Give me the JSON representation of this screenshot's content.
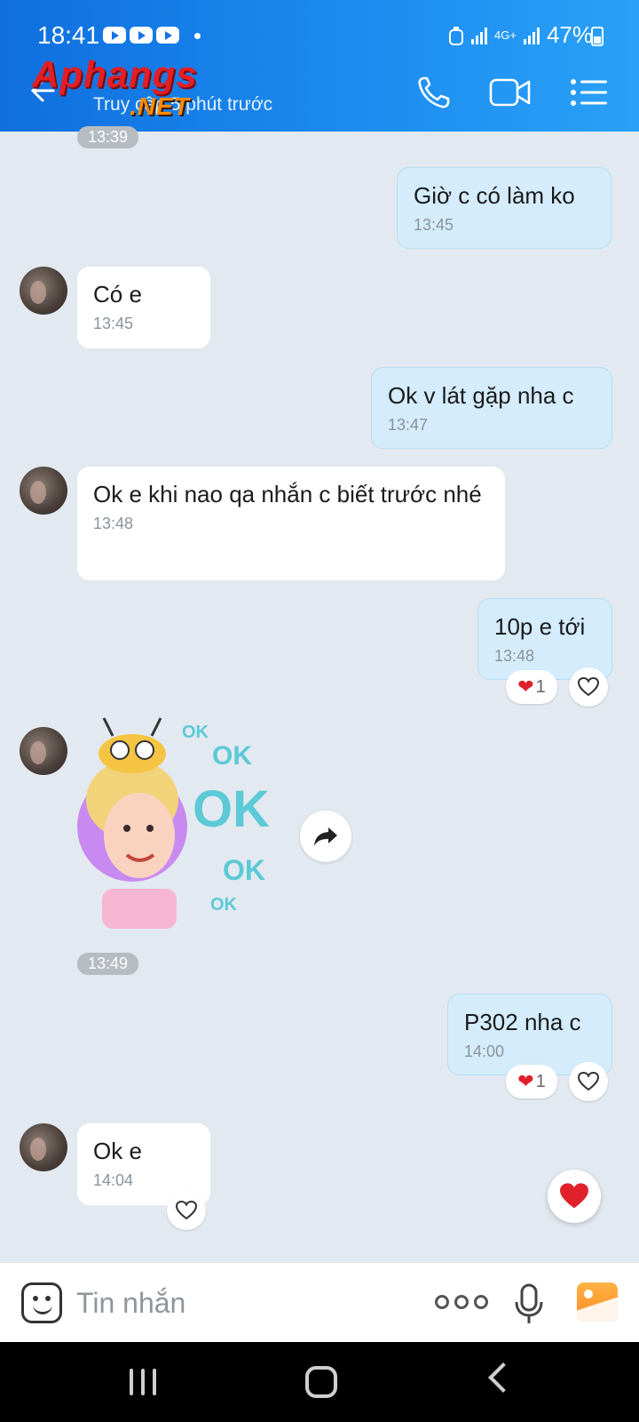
{
  "status_bar": {
    "time": "18:41",
    "network": "4G+",
    "battery": "47%"
  },
  "header": {
    "watermark_main": "Aphangs",
    "watermark_sub": ".NET",
    "subtitle": "Truy cập 5 phút trước",
    "icons": [
      "back-arrow-icon",
      "phone-icon",
      "video-call-icon",
      "menu-icon"
    ],
    "accent": "#1c8bf0"
  },
  "messages": [
    {
      "side": "divider",
      "time": "13:39"
    },
    {
      "side": "out",
      "text": "Giờ c có làm ko",
      "time": "13:45"
    },
    {
      "side": "in",
      "text": "Có e",
      "time": "13:45"
    },
    {
      "side": "out",
      "text": "Ok v lát gặp nha c",
      "time": "13:47"
    },
    {
      "side": "in",
      "text": "Ok e khi nao qa nhắn c biết trước nhé",
      "time": "13:48"
    },
    {
      "side": "out",
      "text": "10p e tới",
      "time": "13:48",
      "reaction_count": "1"
    },
    {
      "side": "in",
      "sticker": "ok-sticker",
      "sticker_labels": [
        "OK",
        "OK",
        "OK",
        "OK",
        "OK"
      ],
      "time": "13:49"
    },
    {
      "side": "out",
      "text": "P302 nha c",
      "time": "14:00",
      "reaction_count": "1"
    },
    {
      "side": "in",
      "text": "Ok e",
      "time": "14:04"
    }
  ],
  "input": {
    "placeholder": "Tin nhắn"
  }
}
